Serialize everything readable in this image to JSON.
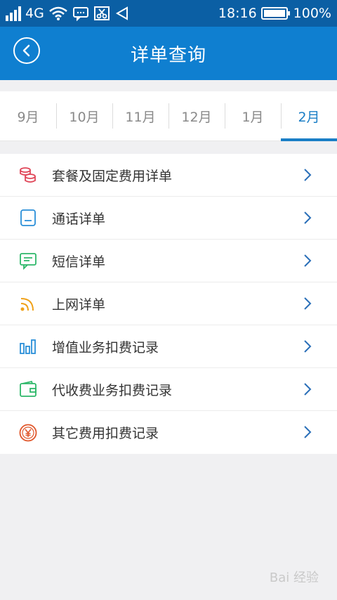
{
  "status_bar": {
    "network": "4G",
    "time": "18:16",
    "battery": "100%"
  },
  "app_bar": {
    "title": "详单查询"
  },
  "month_tabs": [
    {
      "label": "9月",
      "active": false
    },
    {
      "label": "10月",
      "active": false
    },
    {
      "label": "11月",
      "active": false
    },
    {
      "label": "12月",
      "active": false
    },
    {
      "label": "1月",
      "active": false
    },
    {
      "label": "2月",
      "active": true
    }
  ],
  "menu": [
    {
      "label": "套餐及固定费用详单",
      "icon": "coins-icon",
      "color": "#e0485a"
    },
    {
      "label": "通话详单",
      "icon": "phone-card-icon",
      "color": "#2a8fd8"
    },
    {
      "label": "短信详单",
      "icon": "message-icon",
      "color": "#2eb86a"
    },
    {
      "label": "上网详单",
      "icon": "rss-icon",
      "color": "#f0a21a"
    },
    {
      "label": "增值业务扣费记录",
      "icon": "bar-chart-icon",
      "color": "#2a8fd8"
    },
    {
      "label": "代收费业务扣费记录",
      "icon": "wallet-icon",
      "color": "#2eb86a"
    },
    {
      "label": "其它费用扣费记录",
      "icon": "yuan-icon",
      "color": "#e0562a"
    }
  ],
  "watermark": "Bai 经验"
}
